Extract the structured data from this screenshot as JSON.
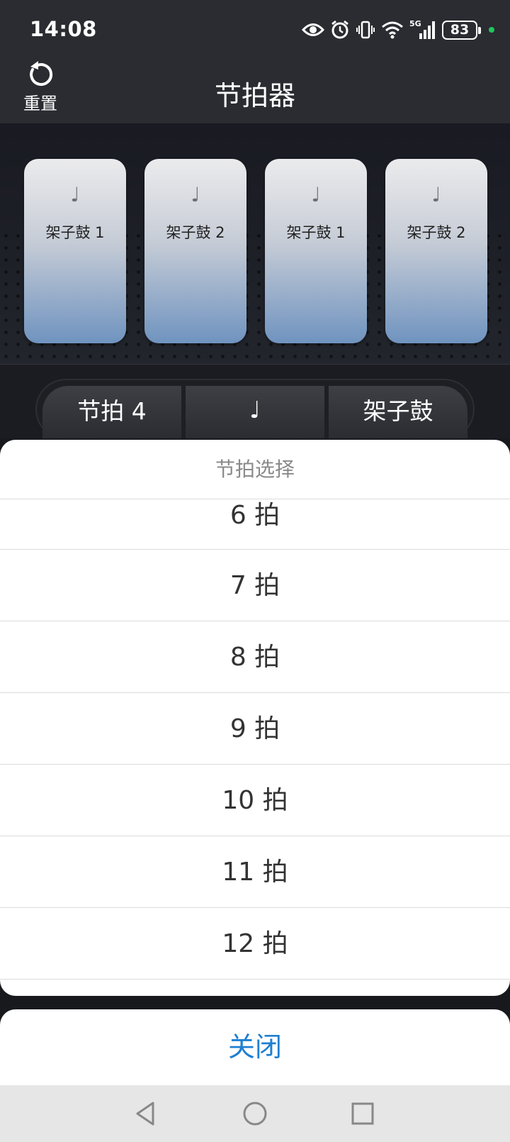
{
  "status_bar": {
    "time": "14:08",
    "network": "5G",
    "battery": "83",
    "icons": [
      "eye-icon",
      "alarm-icon",
      "vibrate-icon",
      "wifi-icon",
      "signal-icon",
      "battery-icon"
    ]
  },
  "header": {
    "reset_label": "重置",
    "title": "节拍器"
  },
  "pads": [
    {
      "note": "♩",
      "label": "架子鼓 1"
    },
    {
      "note": "♩",
      "label": "架子鼓 2"
    },
    {
      "note": "♩",
      "label": "架子鼓 1"
    },
    {
      "note": "♩",
      "label": "架子鼓 2"
    }
  ],
  "segments": {
    "beat": "节拍 4",
    "note": "♩",
    "sound": "架子鼓"
  },
  "picker": {
    "title": "节拍选择",
    "options": [
      "6 拍",
      "7 拍",
      "8 拍",
      "9 拍",
      "10 拍",
      "11 拍",
      "12 拍"
    ]
  },
  "close_label": "关闭",
  "colors": {
    "accent_blue": "#1f7fd1",
    "status_dot": "#22c55e"
  }
}
